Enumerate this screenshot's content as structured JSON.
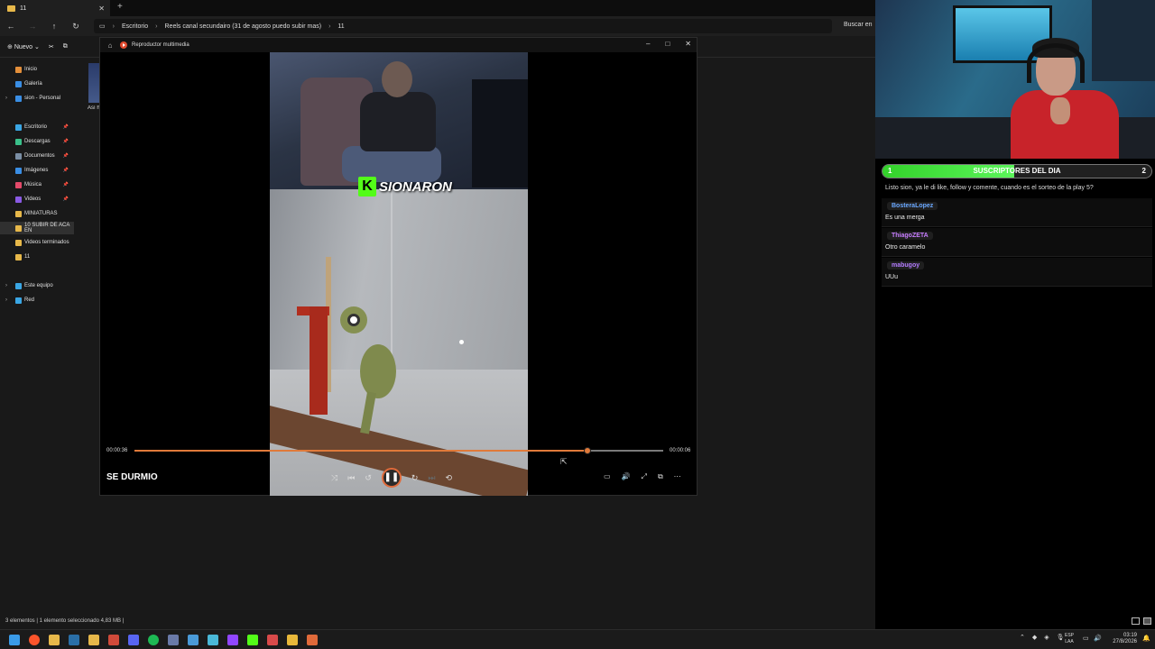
{
  "explorer": {
    "tab_title": "11",
    "tab_close": "✕",
    "tab_add": "+",
    "breadcrumbs": [
      "Escritorio",
      "Reels canal secundairo (31 de agosto puedo subir mas)",
      "11"
    ],
    "search_label": "Buscar en",
    "new_label": "Nuevo",
    "sidebar": [
      {
        "label": "Inicio",
        "color": "#e48f3a",
        "pinned": false
      },
      {
        "label": "Galería",
        "color": "#3a8ee4",
        "pinned": false
      },
      {
        "label": "sion - Personal",
        "color": "#3a8ee4",
        "pinned": false
      },
      {
        "label": "Escritorio",
        "color": "#3aa6e4",
        "pinned": true
      },
      {
        "label": "Descargas",
        "color": "#3ac08a",
        "pinned": true
      },
      {
        "label": "Documentos",
        "color": "#7a8ea4",
        "pinned": true
      },
      {
        "label": "Imágenes",
        "color": "#3a8ee4",
        "pinned": true
      },
      {
        "label": "Música",
        "color": "#e44a6a",
        "pinned": true
      },
      {
        "label": "Videos",
        "color": "#8a5ae4",
        "pinned": true
      },
      {
        "label": "MINIATURAS",
        "color": "#e7b84a",
        "pinned": false
      },
      {
        "label": "10 SUBIR DE ACA EN",
        "color": "#e7b84a",
        "pinned": false
      },
      {
        "label": "Videos terminados",
        "color": "#e7b84a",
        "pinned": false
      },
      {
        "label": "11",
        "color": "#e7b84a",
        "pinned": false
      },
      {
        "label": "Este equipo",
        "color": "#3aa6e4",
        "pinned": false
      },
      {
        "label": "Red",
        "color": "#3aa6e4",
        "pinned": false
      }
    ],
    "file_label": "Así h ter",
    "status_text": "3 elementos  |  1 elemento seleccionado  4,83 MB  |"
  },
  "player": {
    "app_title": "Reproductor multimedia",
    "minimize": "–",
    "maximize": "□",
    "close": "✕",
    "brand_letter": "K",
    "brand_text": "SIONARON",
    "time_current": "00:00:36",
    "time_total": "00:00:06",
    "progress_fraction": 0.856,
    "now_playing": "SE DURMIO",
    "controls": {
      "shuffle": "⤨",
      "previous": "⏮",
      "rewind": "↺",
      "pause": "❚❚",
      "forward": "↻",
      "next": "⏭",
      "repeat": "⟲"
    },
    "right_controls": {
      "miniplayer": "▭",
      "volume": "🔊",
      "fullscreen": "⤢",
      "cast": "⧉",
      "more": "⋯"
    }
  },
  "overlay": {
    "subs_left": "1",
    "subs_title": "SUSCRIPTORES DEL DIA",
    "subs_right": "2",
    "subs_progress": 0.49,
    "chat_top": "Listo sion, ya le di like, follow y comente, cuando es el sorteo de la play 5?",
    "messages": [
      {
        "user": "BosteraLopez",
        "color": "#6aa8ff",
        "text": "Es una merga"
      },
      {
        "user": "ThiagoZETA",
        "color": "#c77dff",
        "text": "Otro caramelo"
      },
      {
        "user": "mabugoy",
        "color": "#b47cff",
        "text": "UUu"
      }
    ]
  },
  "taskbar": {
    "icons": [
      {
        "name": "windows-start",
        "color": "#3a9be8"
      },
      {
        "name": "brave",
        "color": "#fb542b"
      },
      {
        "name": "file-explorer",
        "color": "#e7b84a"
      },
      {
        "name": "steam",
        "color": "#2a6fa8"
      },
      {
        "name": "folder",
        "color": "#e7b84a"
      },
      {
        "name": "chrome-alt",
        "color": "#d04a3a"
      },
      {
        "name": "discord",
        "color": "#5865f2"
      },
      {
        "name": "spotify",
        "color": "#1db954"
      },
      {
        "name": "app-generic",
        "color": "#6a7aa8"
      },
      {
        "name": "vpn",
        "color": "#4a9ad8"
      },
      {
        "name": "puzzle",
        "color": "#4ab8d8"
      },
      {
        "name": "twitch",
        "color": "#9146ff"
      },
      {
        "name": "kick",
        "color": "#53fc18"
      },
      {
        "name": "calendar",
        "color": "#d84a4a"
      },
      {
        "name": "chrome",
        "color": "#e8b83a"
      },
      {
        "name": "media-player",
        "color": "#e06a3a"
      }
    ],
    "lang_top": "ESP",
    "lang_bottom": "LAA",
    "time": "03:19",
    "date": "27/8/2026"
  }
}
